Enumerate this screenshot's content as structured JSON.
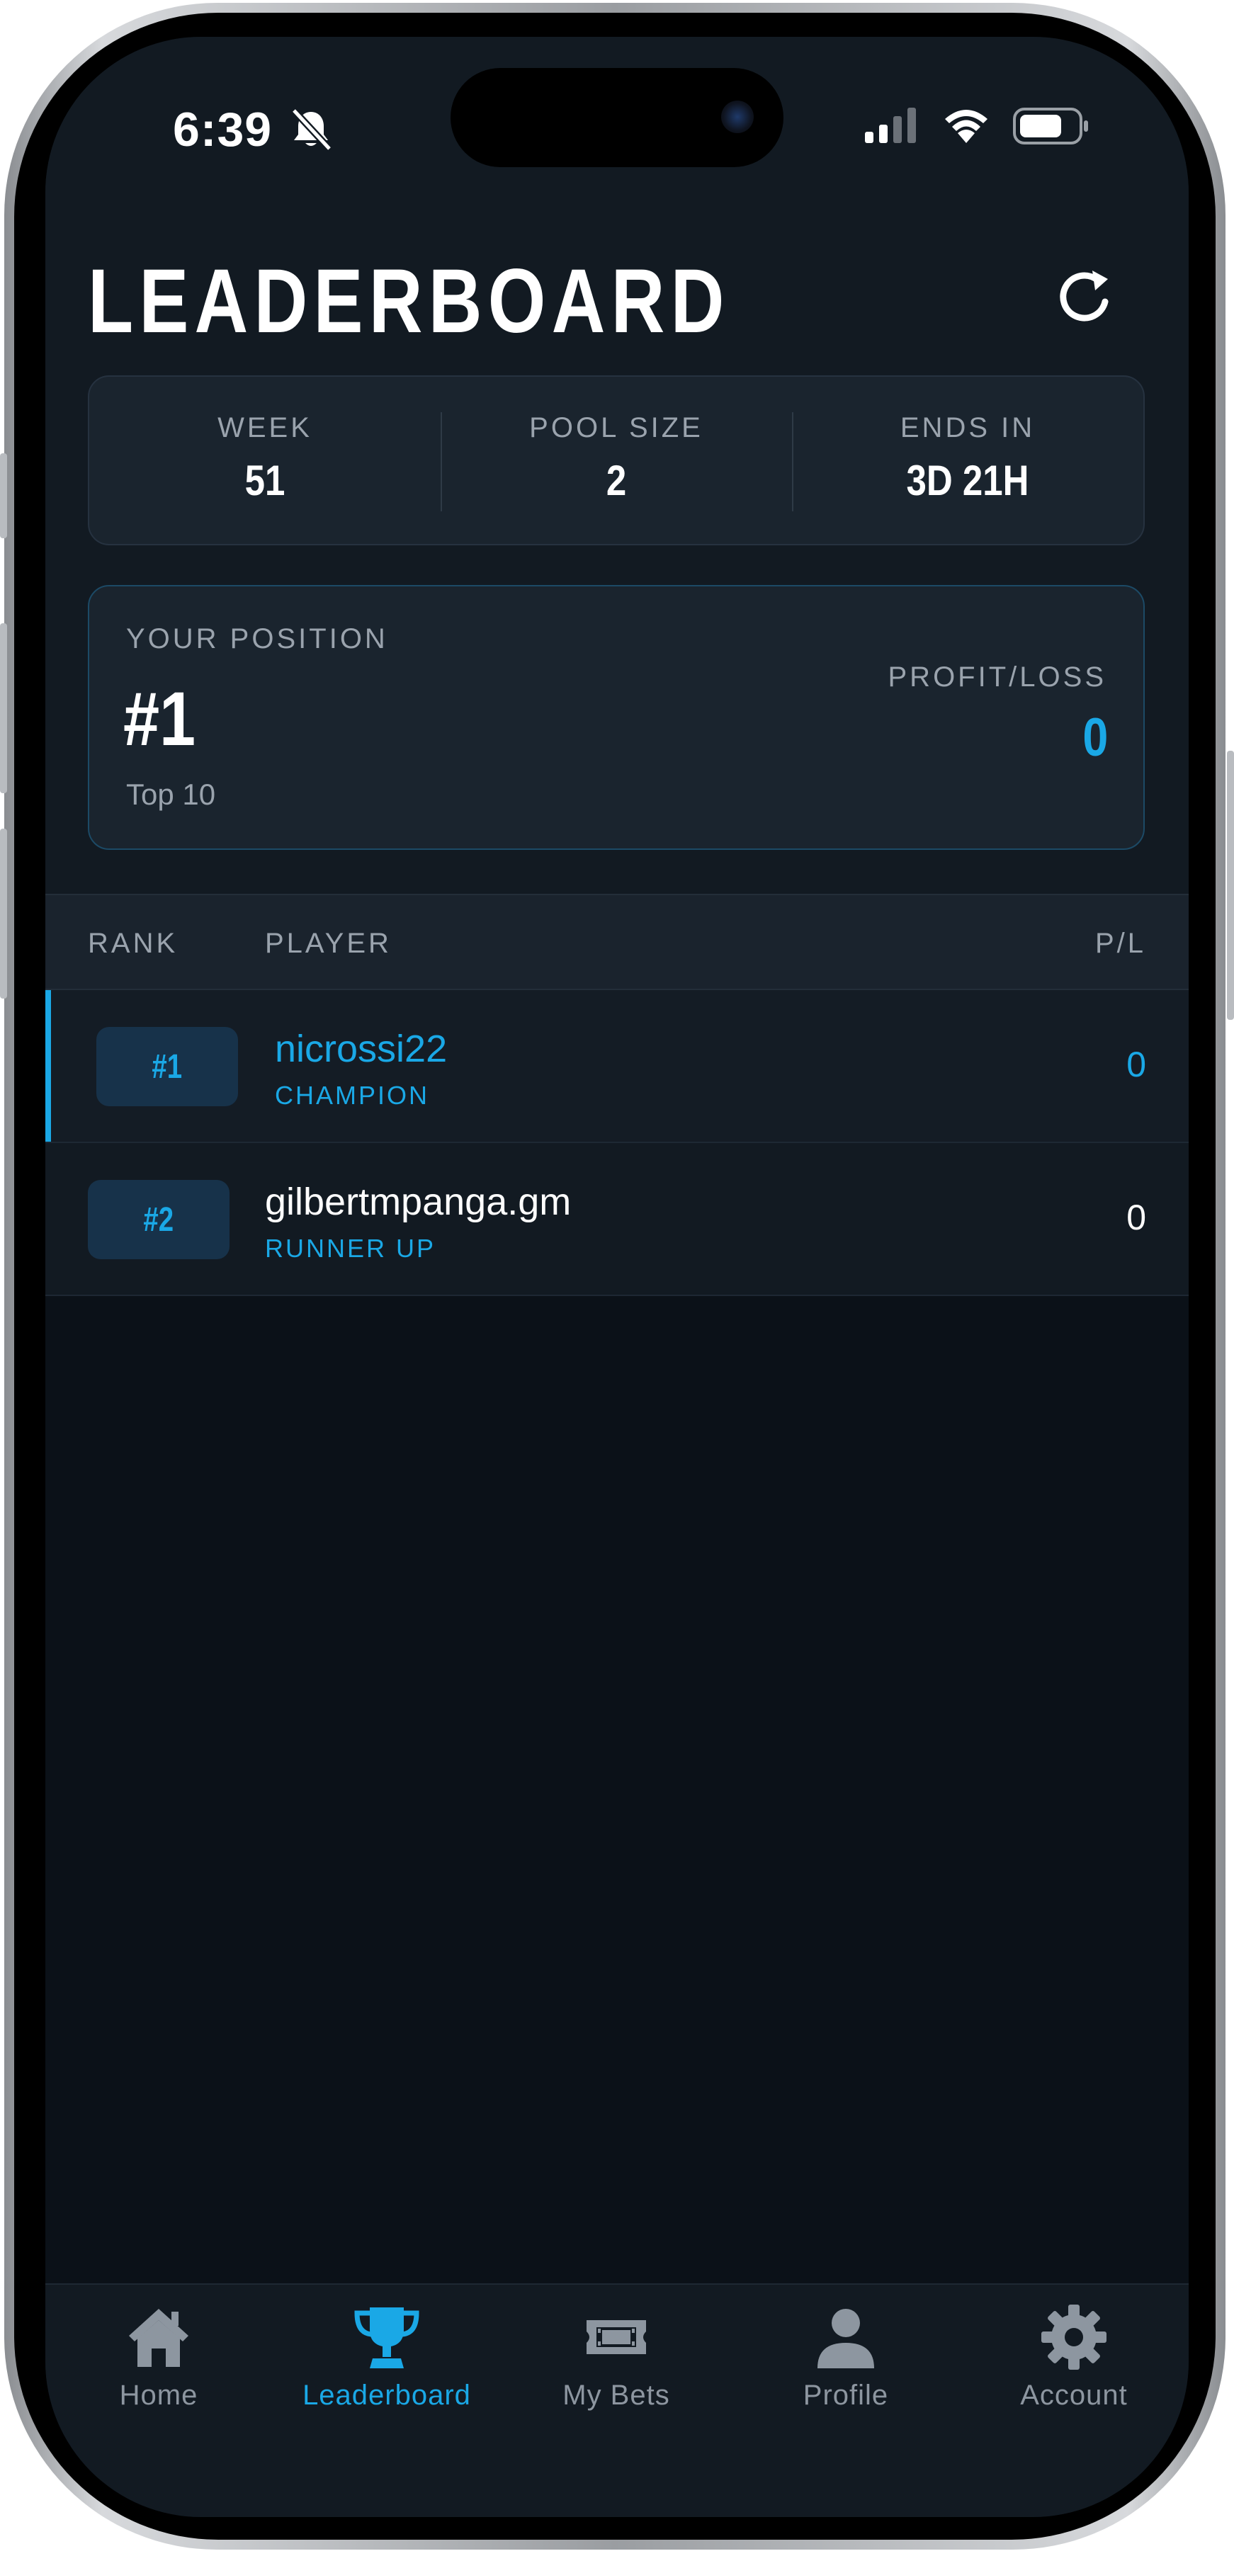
{
  "status_bar": {
    "time": "6:39"
  },
  "header": {
    "title": "LEADERBOARD"
  },
  "stats": [
    {
      "label": "WEEK",
      "value": "51"
    },
    {
      "label": "POOL SIZE",
      "value": "2"
    },
    {
      "label": "ENDS IN",
      "value": "3D 21H"
    }
  ],
  "position": {
    "label": "YOUR POSITION",
    "rank": "#1",
    "sub": "Top 10",
    "pl_label": "PROFIT/LOSS",
    "pl_value": "0"
  },
  "table": {
    "headers": {
      "rank": "RANK",
      "player": "PLAYER",
      "pl": "P/L"
    },
    "rows": [
      {
        "rank": "#1",
        "name": "nicrossi22",
        "tag": "CHAMPION",
        "pl": "0"
      },
      {
        "rank": "#2",
        "name": "gilbertmpanga.gm",
        "tag": "RUNNER UP",
        "pl": "0"
      }
    ]
  },
  "nav": [
    {
      "label": "Home",
      "icon": "home-icon"
    },
    {
      "label": "Leaderboard",
      "icon": "trophy-icon"
    },
    {
      "label": "My Bets",
      "icon": "ticket-icon"
    },
    {
      "label": "Profile",
      "icon": "person-icon"
    },
    {
      "label": "Account",
      "icon": "gear-icon"
    }
  ],
  "colors": {
    "accent": "#1aa8e6",
    "background": "#0b1118",
    "card": "#1a242e",
    "muted_text": "#9aa3ad"
  }
}
